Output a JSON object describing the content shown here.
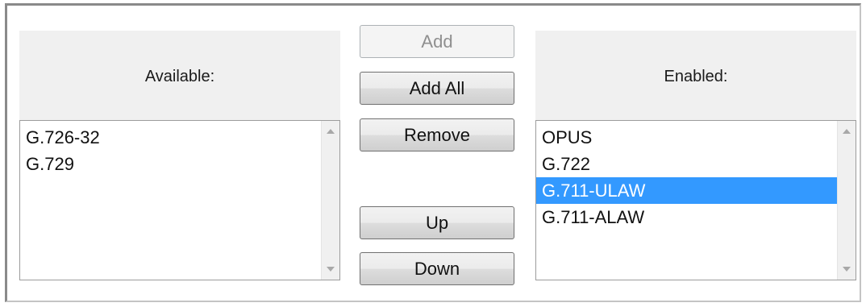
{
  "available": {
    "label": "Available:",
    "items": [
      "G.726-32",
      "G.729"
    ]
  },
  "enabled": {
    "label": "Enabled:",
    "items": [
      "OPUS",
      "G.722",
      "G.711-ULAW",
      "G.711-ALAW"
    ],
    "selected": "G.711-ULAW"
  },
  "buttons": {
    "add": "Add",
    "add_all": "Add All",
    "remove": "Remove",
    "up": "Up",
    "down": "Down"
  },
  "colors": {
    "selection": "#3399ff",
    "panel_bg": "#f0f0f0"
  }
}
